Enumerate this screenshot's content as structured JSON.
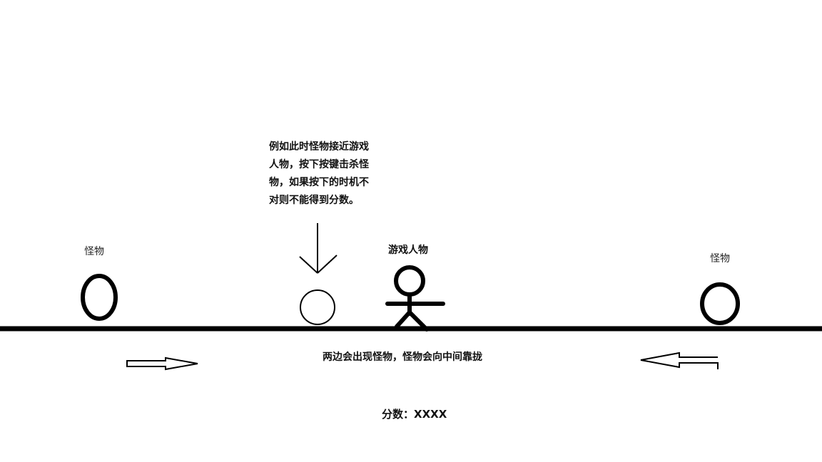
{
  "labels": {
    "monster_left": "怪物",
    "monster_right": "怪物",
    "player": "游戏人物"
  },
  "hint_text": "例如此时怪物接近游戏人物，按下按键击杀怪物，如果按下的时机不对则不能得到分数。",
  "spawn_note": "两边会出现怪物，怪物会向中间靠拢",
  "score": {
    "label": "分数：",
    "value": "XXXX"
  },
  "colors": {
    "background": "#ffffff",
    "ink": "#000000"
  },
  "icons": {
    "monster": "circle",
    "player": "stick-figure",
    "pointer": "down-arrow",
    "move_right": "right-arrow",
    "move_left": "left-arrow"
  }
}
